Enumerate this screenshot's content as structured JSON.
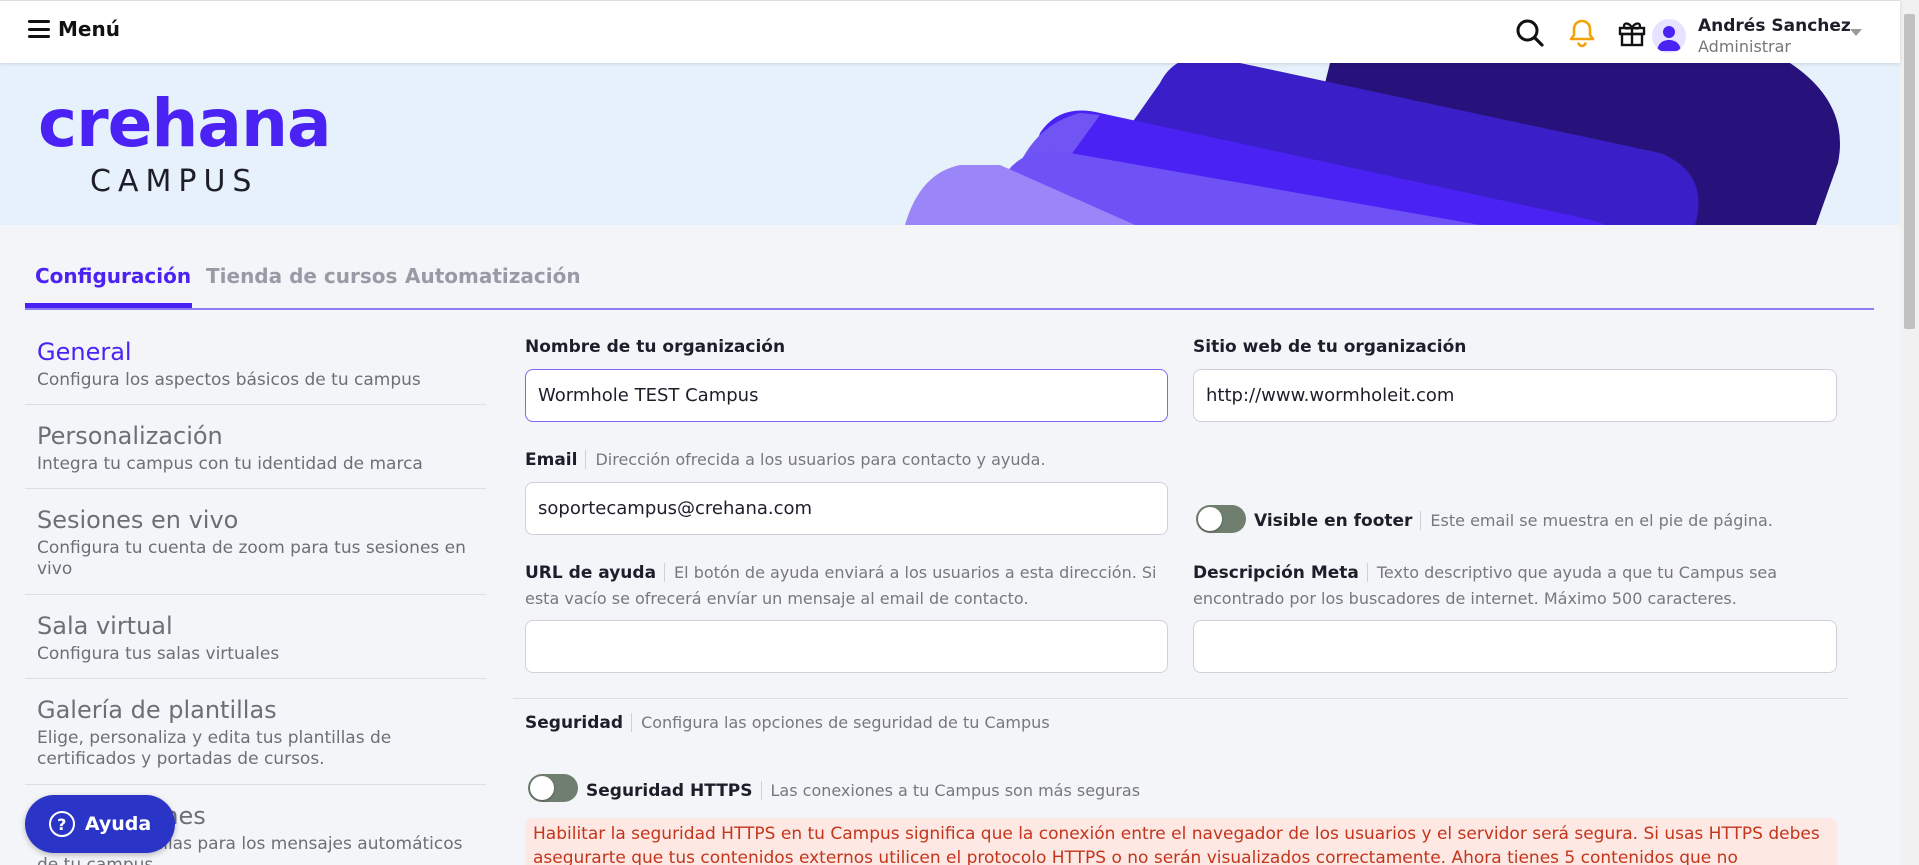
{
  "header": {
    "menu_label": "Menú",
    "user_name": "Andrés Sanchez",
    "user_role": "Administrar"
  },
  "banner": {
    "logo_main": "crehana",
    "logo_sub": "CAMPUS"
  },
  "tabs": [
    {
      "label": "Configuración",
      "active": true
    },
    {
      "label": "Tienda de cursos",
      "active": false
    },
    {
      "label": "Automatización",
      "active": false
    }
  ],
  "sidebar": {
    "items": [
      {
        "title": "General",
        "desc": "Configura los aspectos básicos de tu campus"
      },
      {
        "title": "Personalización",
        "desc": "Integra tu campus con tu identidad de marca"
      },
      {
        "title": "Sesiones en vivo",
        "desc": "Configura tu cuenta de zoom para tus sesiones en vivo"
      },
      {
        "title": "Sala virtual",
        "desc": "Configura tus salas virtuales"
      },
      {
        "title": "Galería de plantillas",
        "desc": "Elige, personaliza y edita tus plantillas de certificados y portadas de cursos."
      },
      {
        "title": "Notificaciones",
        "desc": "Edita las plantillas para los mensajes automáticos de tu campus"
      }
    ]
  },
  "form": {
    "org_name_label": "Nombre de tu organización",
    "org_name_value": "Wormhole TEST Campus",
    "website_label": "Sitio web de tu organización",
    "website_value": "http://www.wormholeit.com",
    "email_label": "Email",
    "email_hint": "Dirección ofrecida a los usuarios para contacto y ayuda.",
    "email_value": "soportecampus@crehana.com",
    "visible_footer_label": "Visible en footer",
    "visible_footer_hint": "Este email se muestra en el pie de página.",
    "help_url_label": "URL de ayuda",
    "help_url_hint": "El botón de ayuda enviará a los usuarios a esta dirección. Si esta vacío se ofrecerá envíar un mensaje al email de contacto.",
    "help_url_value": "",
    "meta_label": "Descripción Meta",
    "meta_hint": "Texto descriptivo que ayuda a que tu Campus sea encontrado por los buscadores de internet. Máximo 500 caracteres.",
    "meta_value": "",
    "security_label": "Seguridad",
    "security_hint": "Configura las opciones de seguridad de tu Campus",
    "https_label": "Seguridad HTTPS",
    "https_hint": "Las conexiones a tu Campus son más seguras",
    "https_alert": "Habilitar la seguridad HTTPS en tu Campus significa que la conexión entre el navegador de los usuarios y el servidor será segura. Si usas HTTPS debes asegurarte que tus contenidos externos utilicen el protocolo HTTPS o no serán visualizados correctamente. Ahora tienes 5 contenidos que no"
  },
  "help_button": {
    "label": "Ayuda"
  },
  "colors": {
    "brand": "#4b22f4",
    "alert_text": "#c4351c",
    "alert_bg": "#fde8e4",
    "toggle_off": "#6f7e6f"
  }
}
